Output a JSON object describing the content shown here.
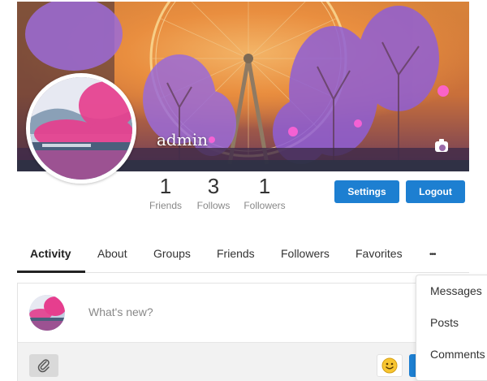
{
  "profile": {
    "name": "admin",
    "stats": [
      {
        "value": "1",
        "label": "Friends"
      },
      {
        "value": "3",
        "label": "Follows"
      },
      {
        "value": "1",
        "label": "Followers"
      }
    ]
  },
  "actions": {
    "settings_label": "Settings",
    "logout_label": "Logout"
  },
  "tabs": [
    {
      "label": "Activity"
    },
    {
      "label": "About"
    },
    {
      "label": "Groups"
    },
    {
      "label": "Friends"
    },
    {
      "label": "Followers"
    },
    {
      "label": "Favorites"
    }
  ],
  "more_label": "•••",
  "composer": {
    "placeholder": "What's new?"
  },
  "more_menu": [
    {
      "label": "Messages"
    },
    {
      "label": "Posts"
    },
    {
      "label": "Comments"
    }
  ],
  "icons": {
    "camera": "camera-icon",
    "attach": "paperclip-icon",
    "emoji": "smiley-icon"
  },
  "colors": {
    "accent": "#1d7fd1",
    "tab_active": "#222222"
  }
}
